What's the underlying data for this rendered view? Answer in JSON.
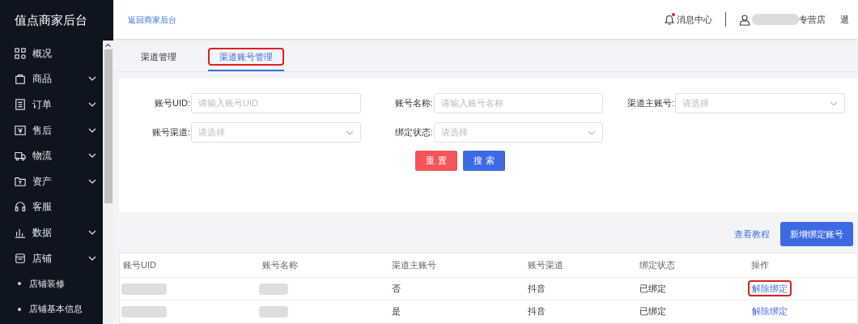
{
  "sidebar": {
    "title": "值点商家后台",
    "items": [
      {
        "label": "概况",
        "has_children": false
      },
      {
        "label": "商品",
        "has_children": true
      },
      {
        "label": "订单",
        "has_children": true
      },
      {
        "label": "售后",
        "has_children": true
      },
      {
        "label": "物流",
        "has_children": true
      },
      {
        "label": "资产",
        "has_children": true
      },
      {
        "label": "客服",
        "has_children": false
      },
      {
        "label": "数据",
        "has_children": true
      },
      {
        "label": "店铺",
        "has_children": true,
        "children": [
          {
            "label": "店铺装修"
          },
          {
            "label": "店铺基本信息"
          }
        ]
      }
    ]
  },
  "header": {
    "back_link": "返回商家后台",
    "messages": "消息中心",
    "has_unread": true,
    "shop_suffix": "专营店",
    "logout": "退"
  },
  "tabs": [
    {
      "label": "渠道管理",
      "selected": false,
      "highlighted": false
    },
    {
      "label": "渠道账号管理",
      "selected": true,
      "highlighted": true
    }
  ],
  "filters": [
    {
      "label": "账号UID:",
      "kind": "input",
      "placeholder": "请输入账号UID"
    },
    {
      "label": "账号名称:",
      "kind": "input",
      "placeholder": "请输入账号名称"
    },
    {
      "label": "渠道主账号:",
      "kind": "select",
      "placeholder": "请选择"
    },
    {
      "label": "账号渠道:",
      "kind": "select",
      "placeholder": "请选择"
    },
    {
      "label": "绑定状态:",
      "kind": "select",
      "placeholder": "请选择"
    }
  ],
  "buttons": {
    "reset": "重 置",
    "search": "搜 索"
  },
  "toolbar": {
    "tutorial_link": "查看教程",
    "add_button": "新增绑定账号"
  },
  "table": {
    "columns": [
      "账号UID",
      "账号名称",
      "渠道主账号",
      "账号渠道",
      "绑定状态",
      "操作"
    ],
    "rows": [
      {
        "main_account": "否",
        "channel": "抖音",
        "status": "已绑定",
        "action": "解除绑定",
        "highlighted": true
      },
      {
        "main_account": "是",
        "channel": "抖音",
        "status": "已绑定",
        "action": "解除绑定",
        "highlighted": false
      }
    ]
  }
}
